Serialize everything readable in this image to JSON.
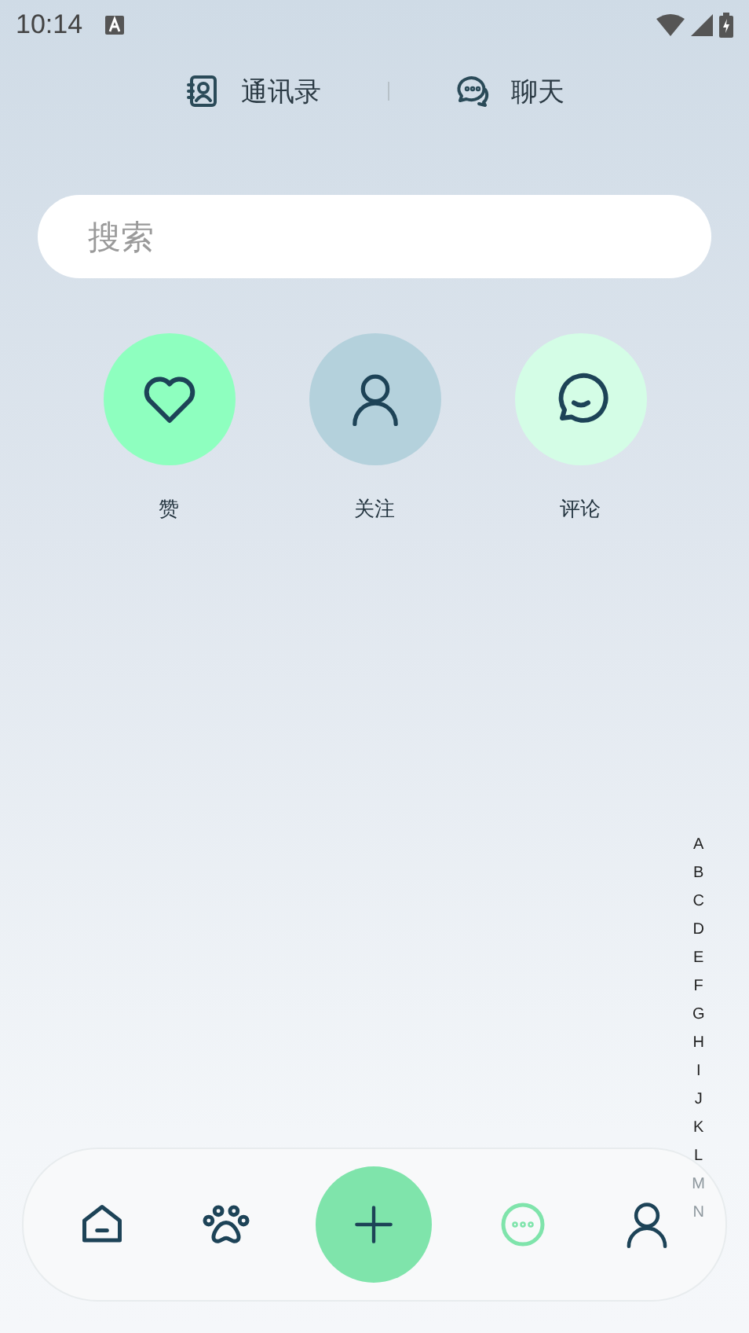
{
  "status_bar": {
    "time": "10:14"
  },
  "top_tabs": [
    {
      "label": "通讯录",
      "kind": "contacts",
      "selected": false
    },
    {
      "label": "聊天",
      "kind": "chat",
      "selected": false
    }
  ],
  "search": {
    "placeholder": "搜索"
  },
  "actions": [
    {
      "label": "赞",
      "kind": "heart",
      "color": "#8effbf"
    },
    {
      "label": "关注",
      "kind": "person",
      "color": "#b4d1dc"
    },
    {
      "label": "评论",
      "kind": "comment",
      "color": "#d4fde6"
    }
  ],
  "index_letters": [
    "A",
    "B",
    "C",
    "D",
    "E",
    "F",
    "G",
    "H",
    "I",
    "J",
    "K",
    "L",
    "M",
    "N"
  ],
  "bottom_nav": [
    {
      "kind": "home",
      "selected": false
    },
    {
      "kind": "paw",
      "selected": false
    },
    {
      "kind": "add",
      "selected": false
    },
    {
      "kind": "chat",
      "selected": true
    },
    {
      "kind": "profile",
      "selected": false
    }
  ]
}
